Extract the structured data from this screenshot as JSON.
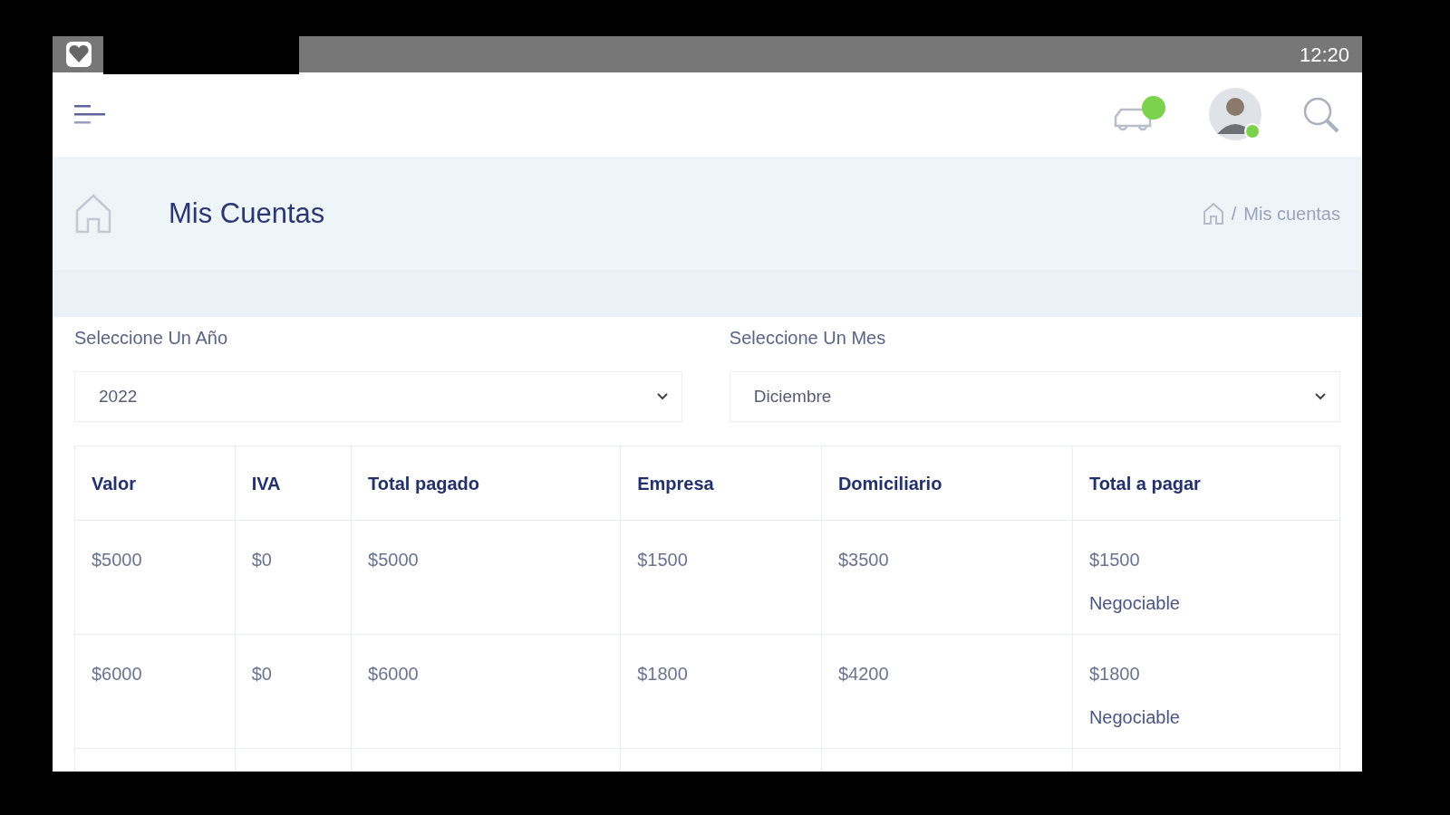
{
  "status_bar": {
    "time": "12:20"
  },
  "app_bar": {
    "avatar": {
      "online": true
    }
  },
  "page_header": {
    "title": "Mis Cuentas",
    "breadcrumb_separator": "/",
    "breadcrumb": [
      "Mis cuentas"
    ]
  },
  "filters": [
    {
      "label": "Seleccione Un Año",
      "value": "2022"
    },
    {
      "label": "Seleccione Un Mes",
      "value": "Diciembre"
    }
  ],
  "table": {
    "columns": [
      "Valor",
      "IVA",
      "Total pagado",
      "Empresa",
      "Domiciliario",
      "Total a pagar"
    ],
    "rows": [
      {
        "cells": [
          "$5000",
          "$0",
          "$5000",
          "$1500",
          "$3500",
          "$1500"
        ],
        "note": "Negociable"
      },
      {
        "cells": [
          "$6000",
          "$0",
          "$6000",
          "$1800",
          "$4200",
          "$1800"
        ],
        "note": "Negociable"
      }
    ]
  }
}
